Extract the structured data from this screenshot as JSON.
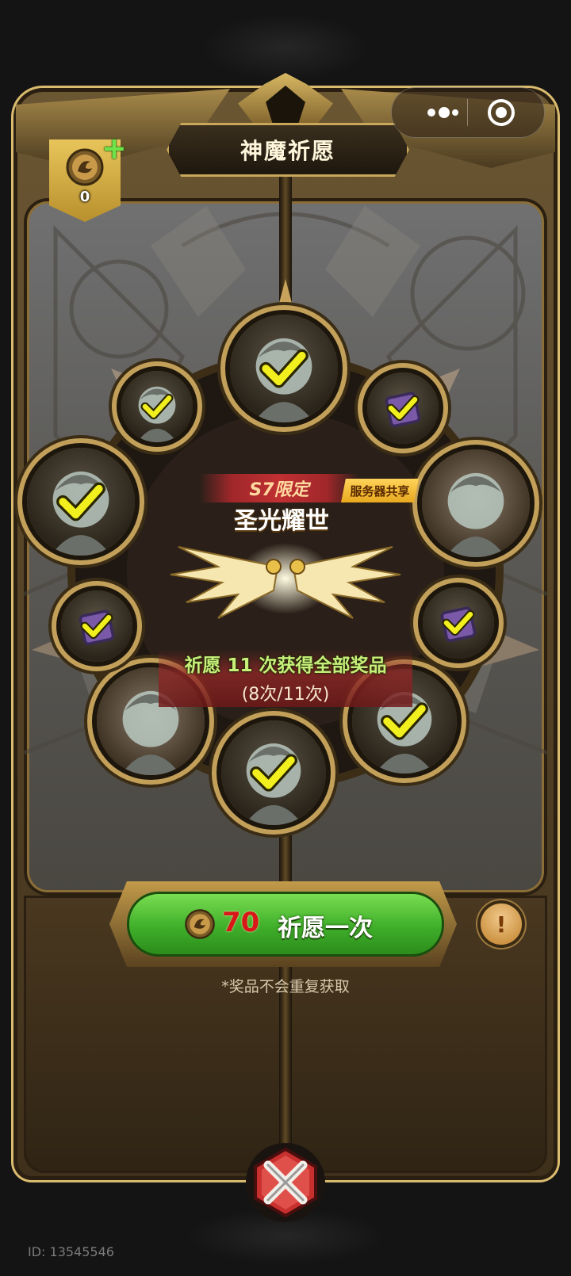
{
  "app": {
    "title": "神魔祈愿",
    "accent_gold": "#c9a75a",
    "button_green": "#3fae2a"
  },
  "capsule": {
    "menu_icon": "more-dots-icon",
    "close_icon": "target-circle-icon"
  },
  "currency": {
    "icon": "wish-coin-icon",
    "count": "0",
    "add_icon": "plus-icon"
  },
  "event": {
    "limited_label": "S7限定",
    "title": "圣光耀世",
    "server_tag": "服务器共享",
    "progress_title": "祈愿 11 次获得全部奖品",
    "progress_count": "(8次/11次)",
    "progress_done": 8,
    "progress_total": 11
  },
  "rewards": [
    {
      "name": "halo-hero-portrait",
      "kind": "character",
      "claimed": true
    },
    {
      "name": "purple-item-crate",
      "kind": "item",
      "claimed": true
    },
    {
      "name": "dark-armored-knight-portrait",
      "kind": "character",
      "claimed": false
    },
    {
      "name": "purple-item-crate",
      "kind": "item",
      "claimed": true
    },
    {
      "name": "golden-hero-portrait",
      "kind": "character",
      "claimed": true
    },
    {
      "name": "red-helmet-knight-portrait",
      "kind": "character",
      "claimed": true
    },
    {
      "name": "purple-horned-girl-portrait",
      "kind": "character",
      "claimed": false
    },
    {
      "name": "gold-medallion",
      "kind": "item",
      "claimed": true
    },
    {
      "name": "horned-demon-portrait",
      "kind": "character",
      "claimed": true
    },
    {
      "name": "golden-warrior-portrait",
      "kind": "character",
      "claimed": true
    }
  ],
  "wish_button": {
    "cost": "70",
    "label": "祈愿一次",
    "coin_icon": "wish-coin-icon"
  },
  "info_button": {
    "symbol": "!"
  },
  "note": "*奖品不会重复获取",
  "close_icon": "close-x-icon",
  "user_id_text": "ID: 13545546"
}
